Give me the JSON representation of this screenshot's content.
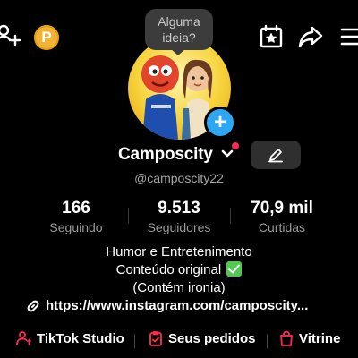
{
  "topbar": {
    "add_user_icon": "person-plus-icon",
    "coin_label": "P",
    "calendar_icon": "calendar-star-icon",
    "share_icon": "share-arrow-icon",
    "menu_icon": "hamburger-menu-icon"
  },
  "avatar": {
    "bubble_text": "Alguma ideia?",
    "add_icon": "plus-icon",
    "add_label": "+"
  },
  "profile": {
    "name": "Camposcity",
    "handle": "@camposcity22"
  },
  "stats": [
    {
      "value": "166",
      "label": "Seguindo"
    },
    {
      "value": "9.513",
      "label": "Seguidores"
    },
    {
      "value": "70,9 mil",
      "label": "Curtidas"
    }
  ],
  "bio": {
    "line1": "Humor e Entretenimento",
    "line2": "Conteúdo original",
    "line3": "(Contém ironia)"
  },
  "link": {
    "text": "https://www.instagram.com/camposcity..."
  },
  "actions": [
    {
      "label": "TikTok Studio",
      "icon": "person-studio-icon"
    },
    {
      "label": "Seus pedidos",
      "icon": "clipboard-check-icon"
    },
    {
      "label": "Vitrine",
      "icon": "shopping-bag-icon"
    }
  ],
  "colors": {
    "background": "#000000",
    "accent_red": "#fe2c55",
    "accent_blue": "#2ea6f2",
    "coin": "#f2b233"
  }
}
